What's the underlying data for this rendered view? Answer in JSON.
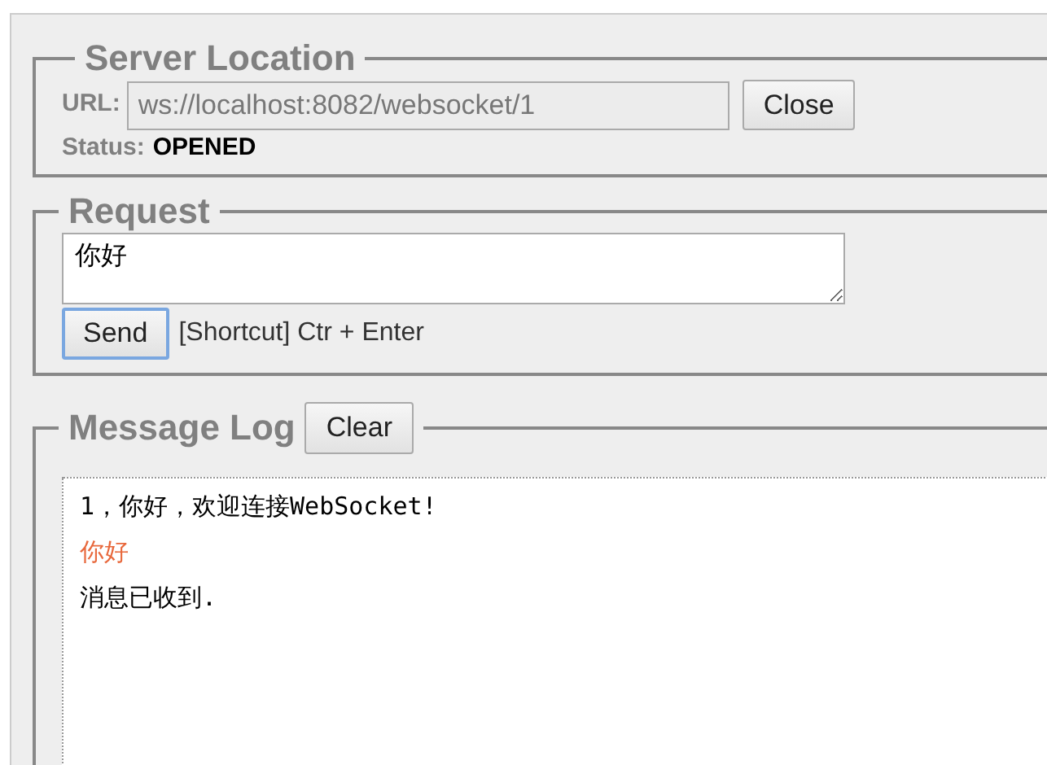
{
  "server": {
    "legend": "Server Location",
    "url_label": "URL:",
    "url": "ws://localhost:8082/websocket/1",
    "close_button": "Close",
    "status_label": "Status:",
    "status": "OPENED"
  },
  "request": {
    "legend": "Request",
    "message": "你好",
    "send_button": "Send",
    "shortcut_hint": "[Shortcut] Ctr + Enter"
  },
  "log": {
    "legend": "Message Log",
    "clear_button": "Clear",
    "entries": [
      {
        "kind": "received",
        "text": "1，你好，欢迎连接WebSocket!"
      },
      {
        "kind": "sent",
        "text": "你好"
      },
      {
        "kind": "received",
        "text": "消息已收到."
      }
    ]
  }
}
